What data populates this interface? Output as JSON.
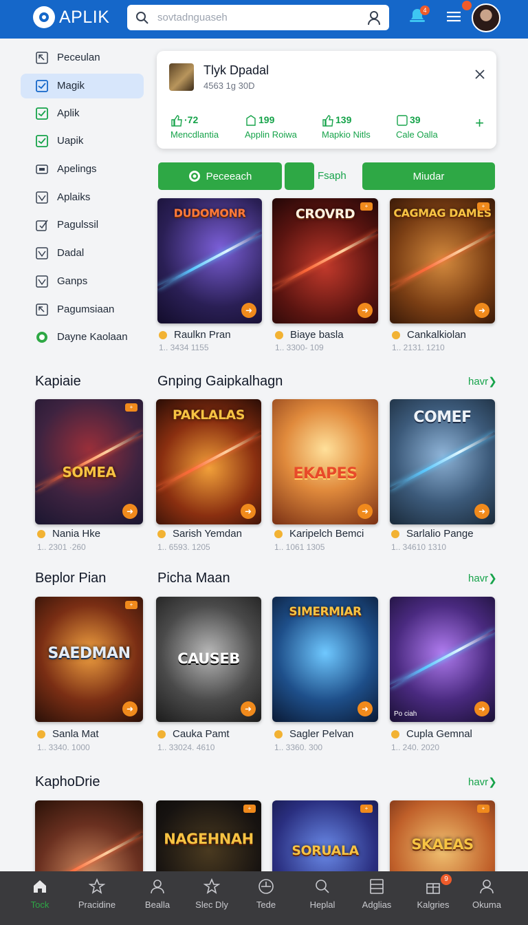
{
  "app": {
    "name": "APLIK"
  },
  "search": {
    "placeholder": "sovtadnguaseh"
  },
  "header": {
    "notification_count": "4"
  },
  "sidebar": {
    "items": [
      {
        "label": "Peceulan",
        "icon": "arrow-box-icon",
        "active": false
      },
      {
        "label": "Magik",
        "icon": "check-box-icon",
        "active": true
      },
      {
        "label": "Aplik",
        "icon": "check-box-green-icon",
        "active": false
      },
      {
        "label": "Uapik",
        "icon": "check-box-green-icon",
        "active": false
      },
      {
        "label": "Apelings",
        "icon": "image-box-icon",
        "active": false
      },
      {
        "label": "Aplaiks",
        "icon": "check-box-icon",
        "active": false
      },
      {
        "label": "Pagulssil",
        "icon": "edit-box-icon",
        "active": false
      },
      {
        "label": "Dadal",
        "icon": "check-box-icon",
        "active": false
      },
      {
        "label": "Ganps",
        "icon": "check-box-icon",
        "active": false
      },
      {
        "label": "Pagumsiaan",
        "icon": "arrow-box-icon",
        "active": false
      },
      {
        "label": "Dayne Kaolaan",
        "icon": "target-icon",
        "active": false
      }
    ]
  },
  "card": {
    "title": "Tlyk Dpadal",
    "subtitle": "4563 1g 30D",
    "stats": [
      {
        "value": "·72",
        "label": "Mencdlantia",
        "icon": "thumbs-up-icon"
      },
      {
        "value": "199",
        "label": "Applin Roiwa",
        "icon": "download-icon"
      },
      {
        "value": "139",
        "label": "Mapkio Nitls",
        "icon": "thumbs-up-icon"
      },
      {
        "value": "39",
        "label": "Cale Oalla",
        "icon": "square-icon"
      }
    ]
  },
  "actions": {
    "primary": "Peceeach",
    "middle": "Fsaph",
    "secondary": "Miudar"
  },
  "sections": [
    {
      "title": "",
      "games": [
        {
          "art": "DUDOMONR",
          "name": "Raulkn Pran",
          "meta": "1.. 3434  1155"
        },
        {
          "art": "CROVRD",
          "name": "Biaye basla",
          "meta": "1.. 3300- 109"
        },
        {
          "art": "CAGMAG DAMES",
          "name": "Cankalkiolan",
          "meta": "1.. 2131. 1210"
        }
      ]
    },
    {
      "title": "Kapiaie",
      "title2": "Gnping Gaipkalhagn",
      "more": "havr",
      "games": [
        {
          "art": "SOMEA",
          "name": "Nania Hke",
          "meta": "1.. 2301  ·260"
        },
        {
          "art": "PAKLALAS",
          "name": "Sarish Yemdan",
          "meta": "1.. 6593. 1205"
        },
        {
          "art": "EKAPES",
          "name": "Karipelch Bemci",
          "meta": "1.. 1061  1305"
        },
        {
          "art": "COMEF",
          "name": "Sarlalio Pange",
          "meta": "1.. 34610 1310"
        }
      ]
    },
    {
      "title": "Beplor Pian",
      "title2": "Picha Maan",
      "more": "havr",
      "games": [
        {
          "art": "SAEDMAN",
          "name": "Sanla Mat",
          "meta": "1.. 3340. 1000"
        },
        {
          "art": "CAUSEB",
          "name": "Cauka Pamt",
          "meta": "1.. 33024. 4610"
        },
        {
          "art": "SIMERMIAR",
          "name": "Sagler Pelvan",
          "meta": "1.. 3360. 300"
        },
        {
          "art": "",
          "name": "Cupla Gemnal",
          "meta": "1.. 240. 2020",
          "badge": "Po ciah"
        }
      ]
    },
    {
      "title": "KaphoDrie",
      "more": "havr",
      "games": [
        {
          "art": ""
        },
        {
          "art": "NAGEHNAH"
        },
        {
          "art": "SORUALA"
        },
        {
          "art": "SKAEAS"
        }
      ]
    }
  ],
  "bottom_nav": [
    {
      "label": "Tock",
      "icon": "home-icon",
      "active": true
    },
    {
      "label": "Pracidine",
      "icon": "star-outline-icon",
      "active": false
    },
    {
      "label": "Bealla",
      "icon": "user-icon",
      "active": false
    },
    {
      "label": "Slec Dly",
      "icon": "star-icon",
      "active": false
    },
    {
      "label": "Tede",
      "icon": "compass-icon",
      "active": false
    },
    {
      "label": "Heplal",
      "icon": "search-icon",
      "active": false
    },
    {
      "label": "Adglias",
      "icon": "list-icon",
      "active": false
    },
    {
      "label": "Kalgries",
      "icon": "gift-icon",
      "active": false,
      "badge": "9"
    },
    {
      "label": "Okuma",
      "icon": "profile-icon",
      "active": false
    }
  ],
  "colors": {
    "primary": "#1567c9",
    "accent": "#2ea845",
    "badge": "#f08a1c"
  }
}
